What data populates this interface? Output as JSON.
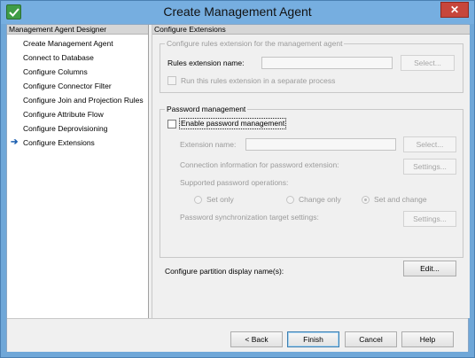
{
  "window": {
    "title": "Create Management Agent",
    "close_label": "✕"
  },
  "left_panel": {
    "header": "Management Agent Designer",
    "items": [
      {
        "label": "Create Management Agent",
        "current": false
      },
      {
        "label": "Connect to Database",
        "current": false
      },
      {
        "label": "Configure Columns",
        "current": false
      },
      {
        "label": "Configure Connector Filter",
        "current": false
      },
      {
        "label": "Configure Join and Projection Rules",
        "current": false
      },
      {
        "label": "Configure Attribute Flow",
        "current": false
      },
      {
        "label": "Configure Deprovisioning",
        "current": false
      },
      {
        "label": "Configure Extensions",
        "current": true
      }
    ],
    "current_arrow": "➔"
  },
  "right_panel": {
    "header": "Configure Extensions",
    "rules_group": {
      "legend": "Configure rules extension for the management agent",
      "name_label": "Rules extension name:",
      "name_value": "",
      "select_button": "Select...",
      "separate_process_label": "Run this rules extension in a separate process",
      "separate_process_checked": false
    },
    "password_group": {
      "legend": "Password management",
      "enable_label": "Enable password management",
      "enable_checked": false,
      "extension_name_label": "Extension name:",
      "extension_name_value": "",
      "select_button": "Select...",
      "connection_info_label": "Connection information for password extension:",
      "settings_button_1": "Settings...",
      "supported_ops_label": "Supported password operations:",
      "radio_options": [
        "Set only",
        "Change only",
        "Set and change"
      ],
      "radio_selected": "Set and change",
      "sync_target_label": "Password synchronization target settings:",
      "settings_button_2": "Settings..."
    },
    "partition_label": "Configure partition display name(s):",
    "edit_button": "Edit..."
  },
  "buttons": {
    "back": "< Back",
    "finish": "Finish",
    "cancel": "Cancel",
    "help": "Help"
  }
}
